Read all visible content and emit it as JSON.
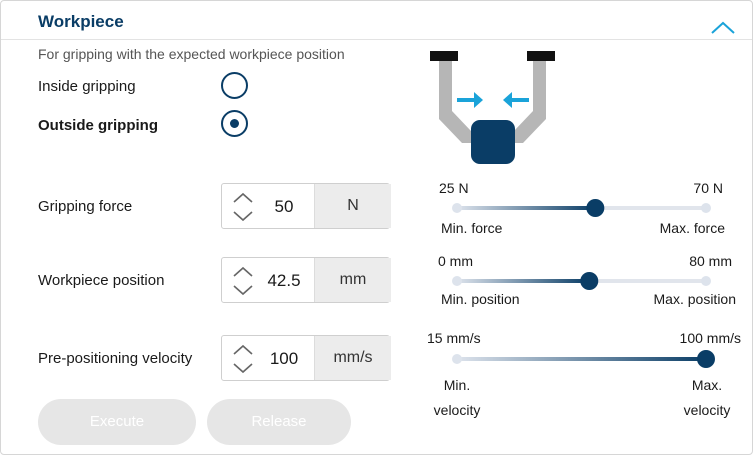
{
  "section": {
    "title": "Workpiece",
    "subtitle": "For gripping with the expected workpiece position"
  },
  "gripping": {
    "inside_label": "Inside gripping",
    "outside_label": "Outside gripping",
    "selected": "outside"
  },
  "params": [
    {
      "label": "Gripping force",
      "value": "50",
      "unit": "N"
    },
    {
      "label": "Workpiece position",
      "value": "42.5",
      "unit": "mm"
    },
    {
      "label": "Pre-positioning velocity",
      "value": "100",
      "unit": "mm/s"
    }
  ],
  "sliders": [
    {
      "min_value": "25 N",
      "max_value": "70 N",
      "min_label": "Min. force",
      "max_label": "Max. force",
      "min": 25,
      "max": 70,
      "value": 50
    },
    {
      "min_value": "0 mm",
      "max_value": "80 mm",
      "min_label": "Min. position",
      "max_label": "Max. position",
      "min": 0,
      "max": 80,
      "value": 42.5
    },
    {
      "min_value": "15 mm/s",
      "max_value": "100 mm/s",
      "min_label": "Min.\nvelocity",
      "max_label": "Max.\nvelocity",
      "min": 15,
      "max": 100,
      "value": 100
    }
  ],
  "buttons": {
    "execute": "Execute",
    "release": "Release"
  },
  "colors": {
    "accent": "#0a3d66",
    "arrow": "#1aa3d9",
    "disabled_button": "#e6e6e6"
  },
  "icons": {
    "collapse": "chevron-up-icon",
    "stepper": "up-down-chevron-icon"
  }
}
